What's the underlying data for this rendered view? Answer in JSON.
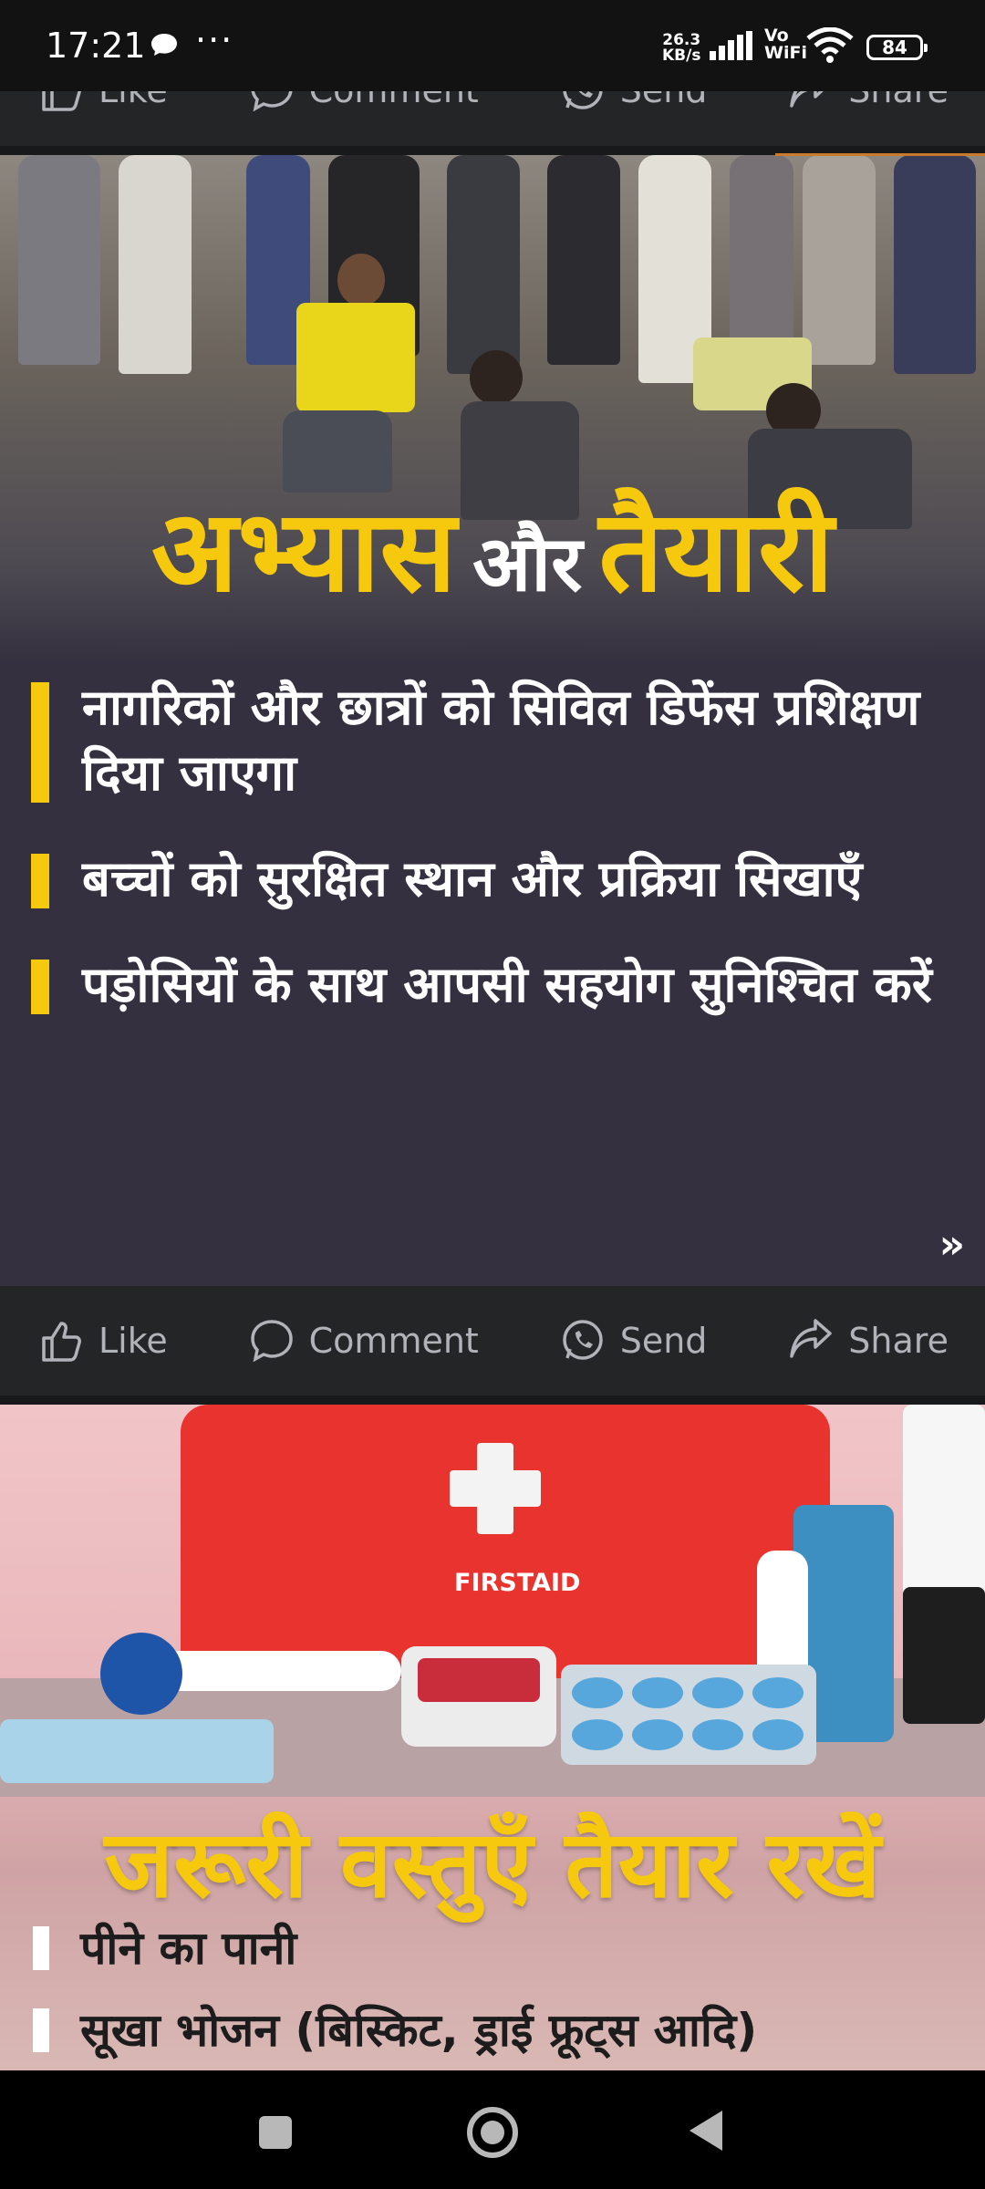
{
  "status_bar": {
    "time": "17:21",
    "dots": "···",
    "net_speed_value": "26.3",
    "net_speed_unit": "KB/s",
    "vo": "Vo",
    "wifi_label": "WiFi",
    "battery": "84"
  },
  "actions": {
    "like": "Like",
    "comment": "Comment",
    "send": "Send",
    "share": "Share"
  },
  "post1": {
    "headline_left": "अभ्यास",
    "headline_mid": "और",
    "headline_right": "तैयारी",
    "bullets": [
      "नागरिकों और छात्रों को सिविल डिफेंस प्रशिक्षण दिया जाएगा",
      "बच्चों को सुरक्षित स्थान और प्रक्रिया सिखाएँ",
      "पड़ोसियों के साथ आपसी सहयोग सुनिश्चित करें"
    ],
    "next_arrow": "»"
  },
  "post2": {
    "kit_label": "FIRSTAID",
    "headline": "जरूरी वस्तुएँ तैयार रखें",
    "items": [
      "पीने का पानी",
      "सूखा भोजन (बिस्किट, ड्राई फ्रूट्स आदि)"
    ]
  },
  "colors": {
    "accent_yellow": "#f6c90e",
    "card_dark": "#34303f",
    "action_bar": "#242526"
  }
}
